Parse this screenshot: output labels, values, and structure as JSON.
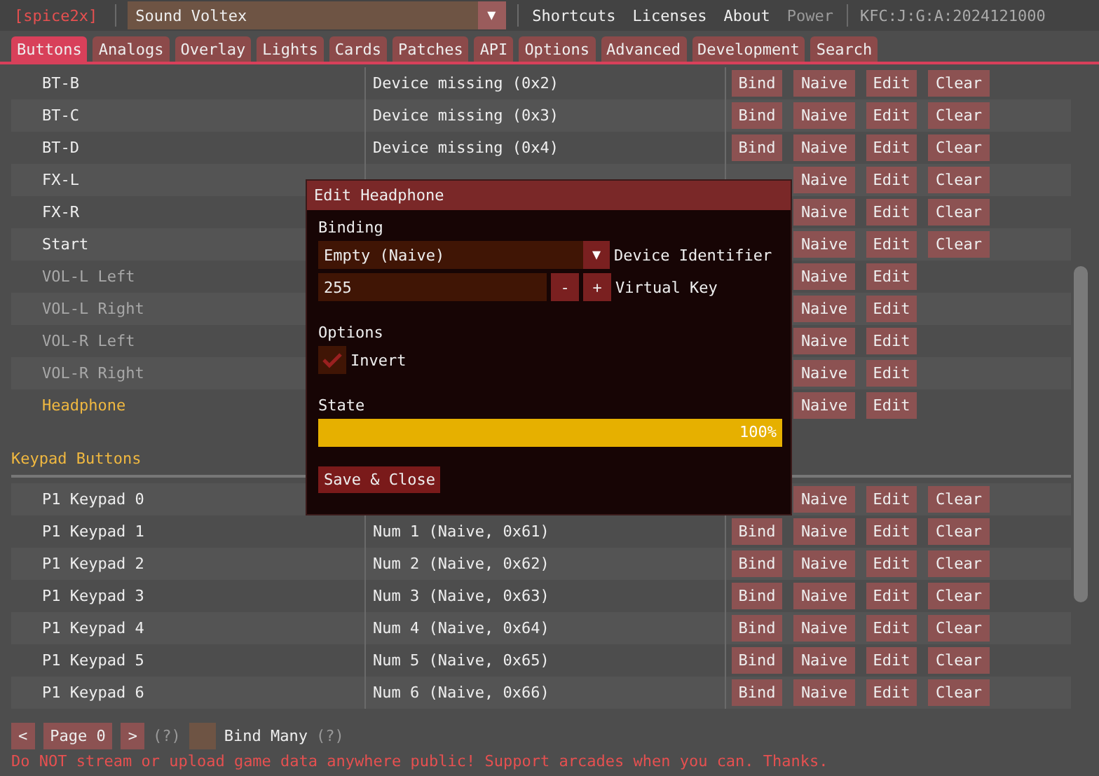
{
  "top_bar": {
    "logo": "[spice2x]",
    "game_select": {
      "value": "Sound Voltex",
      "arrow": "▼"
    },
    "menu": [
      {
        "label": "Shortcuts",
        "disabled": false
      },
      {
        "label": "Licenses",
        "disabled": false
      },
      {
        "label": "About",
        "disabled": false
      },
      {
        "label": "Power",
        "disabled": true
      }
    ],
    "version": "KFC:J:G:A:2024121000"
  },
  "tabs": [
    {
      "label": "Buttons",
      "selected": true
    },
    {
      "label": "Analogs",
      "selected": false
    },
    {
      "label": "Overlay",
      "selected": false
    },
    {
      "label": "Lights",
      "selected": false
    },
    {
      "label": "Cards",
      "selected": false
    },
    {
      "label": "Patches",
      "selected": false
    },
    {
      "label": "API",
      "selected": false
    },
    {
      "label": "Options",
      "selected": false
    },
    {
      "label": "Advanced",
      "selected": false
    },
    {
      "label": "Development",
      "selected": false
    },
    {
      "label": "Search",
      "selected": false
    }
  ],
  "groups": [
    {
      "rows": [
        {
          "name": "BT-B",
          "disabled": false,
          "active": false,
          "binding": "Device missing (0x2)",
          "buttons": [
            {
              "kind": "bind",
              "label": "Bind"
            },
            {
              "kind": "naive",
              "label": "Naive"
            },
            {
              "kind": "edit",
              "label": "Edit"
            },
            {
              "kind": "clear",
              "label": "Clear"
            }
          ]
        },
        {
          "name": "BT-C",
          "disabled": false,
          "active": false,
          "binding": "Device missing (0x3)",
          "buttons": [
            {
              "kind": "bind",
              "label": "Bind"
            },
            {
              "kind": "naive",
              "label": "Naive"
            },
            {
              "kind": "edit",
              "label": "Edit"
            },
            {
              "kind": "clear",
              "label": "Clear"
            }
          ]
        },
        {
          "name": "BT-D",
          "disabled": false,
          "active": false,
          "binding": "Device missing (0x4)",
          "buttons": [
            {
              "kind": "bind",
              "label": "Bind"
            },
            {
              "kind": "naive",
              "label": "Naive"
            },
            {
              "kind": "edit",
              "label": "Edit"
            },
            {
              "kind": "clear",
              "label": "Clear"
            }
          ]
        },
        {
          "name": "FX-L",
          "disabled": false,
          "active": false,
          "buttons": [
            {
              "kind": "naive",
              "label": "Naive"
            },
            {
              "kind": "edit",
              "label": "Edit"
            },
            {
              "kind": "clear",
              "label": "Clear"
            }
          ]
        },
        {
          "name": "FX-R",
          "disabled": false,
          "active": false,
          "buttons": [
            {
              "kind": "naive",
              "label": "Naive"
            },
            {
              "kind": "edit",
              "label": "Edit"
            },
            {
              "kind": "clear",
              "label": "Clear"
            }
          ]
        },
        {
          "name": "Start",
          "disabled": false,
          "active": false,
          "buttons": [
            {
              "kind": "naive",
              "label": "Naive"
            },
            {
              "kind": "edit",
              "label": "Edit"
            },
            {
              "kind": "clear",
              "label": "Clear"
            }
          ]
        },
        {
          "name": "VOL-L Left",
          "disabled": true,
          "active": false,
          "buttons": [
            {
              "kind": "naive",
              "label": "Naive"
            },
            {
              "kind": "edit",
              "label": "Edit"
            }
          ]
        },
        {
          "name": "VOL-L Right",
          "disabled": true,
          "active": false,
          "buttons": [
            {
              "kind": "naive",
              "label": "Naive"
            },
            {
              "kind": "edit",
              "label": "Edit"
            }
          ]
        },
        {
          "name": "VOL-R Left",
          "disabled": true,
          "active": false,
          "buttons": [
            {
              "kind": "naive",
              "label": "Naive"
            },
            {
              "kind": "edit",
              "label": "Edit"
            }
          ]
        },
        {
          "name": "VOL-R Right",
          "disabled": true,
          "active": false,
          "buttons": [
            {
              "kind": "naive",
              "label": "Naive"
            },
            {
              "kind": "edit",
              "label": "Edit"
            }
          ]
        },
        {
          "name": "Headphone",
          "disabled": false,
          "active": true,
          "buttons": [
            {
              "kind": "naive",
              "label": "Naive"
            },
            {
              "kind": "edit",
              "label": "Edit"
            }
          ]
        }
      ]
    },
    {
      "title": "Keypad Buttons",
      "rows": [
        {
          "name": "P1 Keypad 0",
          "disabled": false,
          "active": false,
          "buttons": [
            {
              "kind": "naive",
              "label": "Naive"
            },
            {
              "kind": "edit",
              "label": "Edit"
            },
            {
              "kind": "clear",
              "label": "Clear"
            }
          ]
        },
        {
          "name": "P1 Keypad 1",
          "disabled": false,
          "active": false,
          "binding": "Num 1 (Naive, 0x61)",
          "buttons": [
            {
              "kind": "bind",
              "label": "Bind"
            },
            {
              "kind": "naive",
              "label": "Naive"
            },
            {
              "kind": "edit",
              "label": "Edit"
            },
            {
              "kind": "clear",
              "label": "Clear"
            }
          ]
        },
        {
          "name": "P1 Keypad 2",
          "disabled": false,
          "active": false,
          "binding": "Num 2 (Naive, 0x62)",
          "buttons": [
            {
              "kind": "bind",
              "label": "Bind"
            },
            {
              "kind": "naive",
              "label": "Naive"
            },
            {
              "kind": "edit",
              "label": "Edit"
            },
            {
              "kind": "clear",
              "label": "Clear"
            }
          ]
        },
        {
          "name": "P1 Keypad 3",
          "disabled": false,
          "active": false,
          "binding": "Num 3 (Naive, 0x63)",
          "buttons": [
            {
              "kind": "bind",
              "label": "Bind"
            },
            {
              "kind": "naive",
              "label": "Naive"
            },
            {
              "kind": "edit",
              "label": "Edit"
            },
            {
              "kind": "clear",
              "label": "Clear"
            }
          ]
        },
        {
          "name": "P1 Keypad 4",
          "disabled": false,
          "active": false,
          "binding": "Num 4 (Naive, 0x64)",
          "buttons": [
            {
              "kind": "bind",
              "label": "Bind"
            },
            {
              "kind": "naive",
              "label": "Naive"
            },
            {
              "kind": "edit",
              "label": "Edit"
            },
            {
              "kind": "clear",
              "label": "Clear"
            }
          ]
        },
        {
          "name": "P1 Keypad 5",
          "disabled": false,
          "active": false,
          "binding": "Num 5 (Naive, 0x65)",
          "buttons": [
            {
              "kind": "bind",
              "label": "Bind"
            },
            {
              "kind": "naive",
              "label": "Naive"
            },
            {
              "kind": "edit",
              "label": "Edit"
            },
            {
              "kind": "clear",
              "label": "Clear"
            }
          ]
        },
        {
          "name": "P1 Keypad 6",
          "disabled": false,
          "active": false,
          "binding": "Num 6 (Naive, 0x66)",
          "buttons": [
            {
              "kind": "bind",
              "label": "Bind"
            },
            {
              "kind": "naive",
              "label": "Naive"
            },
            {
              "kind": "edit",
              "label": "Edit"
            },
            {
              "kind": "clear",
              "label": "Clear"
            }
          ]
        }
      ]
    }
  ],
  "dialog": {
    "title": "Edit Headphone",
    "binding_label": "Binding",
    "device": {
      "value": "Empty (Naive)",
      "arrow": "▼"
    },
    "device_label": "Device Identifier",
    "key": {
      "value": "255",
      "minus": "-",
      "plus": "+"
    },
    "key_label": "Virtual Key",
    "options_label": "Options",
    "invert": {
      "label": "Invert",
      "checked": true
    },
    "state_label": "State",
    "state": {
      "level": 1,
      "reading": "100%"
    },
    "save": "Save & Close"
  },
  "footer": {
    "prev": "<",
    "page": "Page 0",
    "next": ">",
    "help_1": "(?)",
    "bind_many": {
      "label": "Bind Many",
      "checked": false
    },
    "help_2": "(?)",
    "warning": "Do NOT stream or upload game data anywhere public! Support arcades when you can. Thanks."
  }
}
